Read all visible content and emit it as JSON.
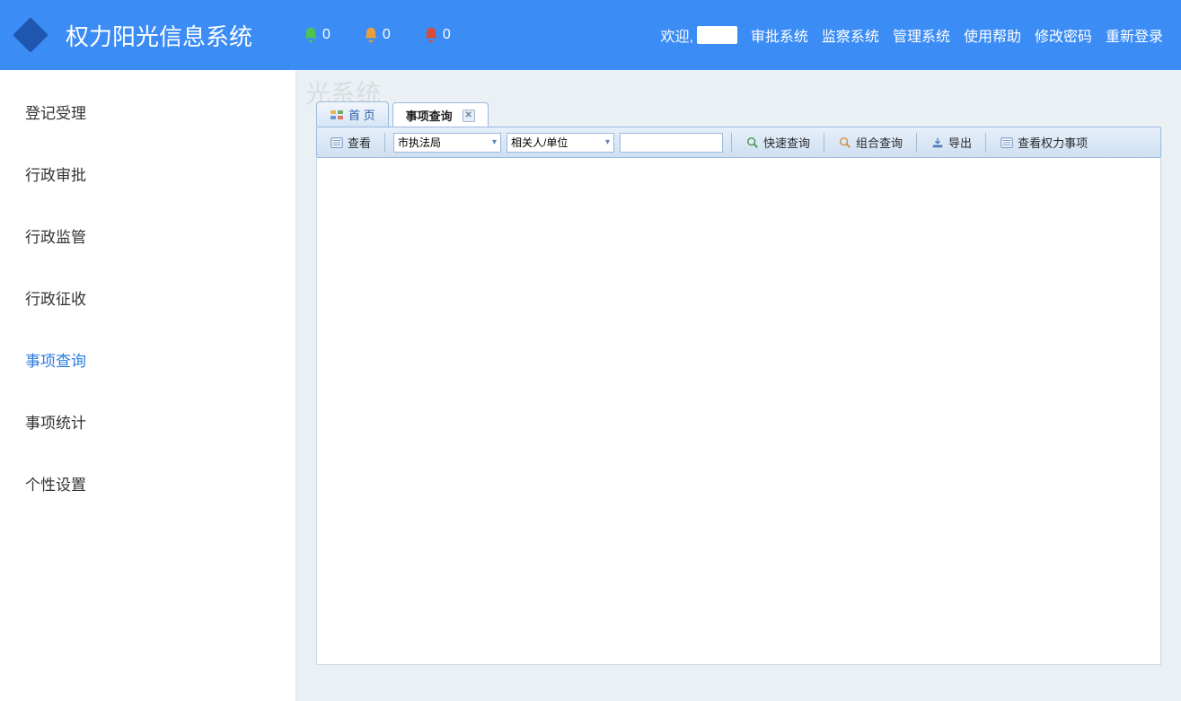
{
  "header": {
    "title": "权力阳光信息系统",
    "bells": [
      {
        "color": "#4fc34f",
        "count": "0"
      },
      {
        "color": "#e8a03a",
        "count": "0"
      },
      {
        "color": "#d84c3a",
        "count": "0"
      }
    ],
    "welcome": "欢迎,",
    "nav": [
      "审批系统",
      "监察系统",
      "管理系统",
      "使用帮助",
      "修改密码",
      "重新登录"
    ]
  },
  "sidebar": {
    "items": [
      "登记受理",
      "行政审批",
      "行政监管",
      "行政征收",
      "事项查询",
      "事项统计",
      "个性设置"
    ],
    "activeIndex": 4
  },
  "tabs": {
    "home": "首 页",
    "active": "事项查询"
  },
  "toolbar": {
    "view": "查看",
    "select1": "市执法局",
    "select2": "相关人/单位",
    "quick_search": "快速查询",
    "adv_search": "组合查询",
    "export": "导出",
    "view_power": "查看权力事项"
  },
  "watermark_tl": "光系统",
  "watermark_br": ""
}
